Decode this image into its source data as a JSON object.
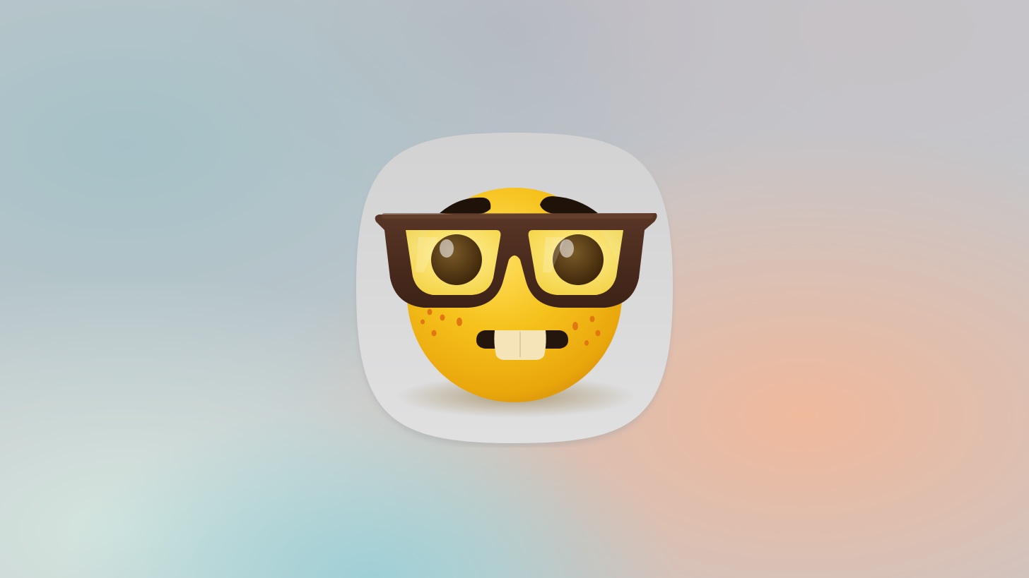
{
  "scene": {
    "subject": "nerd-face-app-icon",
    "icon_name": "nerd-face-icon"
  },
  "colors": {
    "background_top_left": "#a9c3c9",
    "background_top_center": "#bebcc2",
    "background_right": "#efbfa6",
    "background_bottom_left": "#cfe1dd",
    "background_bottom_center": "#a7cfd6",
    "icon_tile": "#d8d8d9",
    "face_yellow": "#f7c21b",
    "face_orange": "#e8a10b",
    "glasses_frame": "#4a2c1f",
    "lens_tint": "#f3d94a",
    "pupil": "#4b3314",
    "tooth": "#f5e3b6",
    "freckles": "#e57b16"
  }
}
